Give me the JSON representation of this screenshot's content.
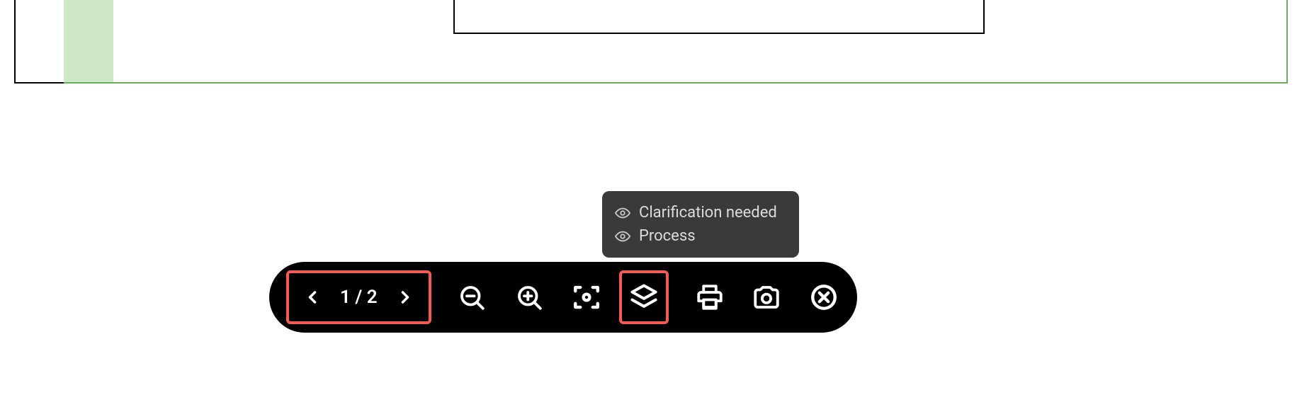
{
  "pager": {
    "current": "1",
    "separator": "/",
    "total": "2"
  },
  "layers_popup": {
    "items": [
      {
        "label": "Clarification needed"
      },
      {
        "label": "Process"
      }
    ]
  },
  "highlights": {
    "pager_color": "#f25c54",
    "layers_color": "#f25c54"
  }
}
